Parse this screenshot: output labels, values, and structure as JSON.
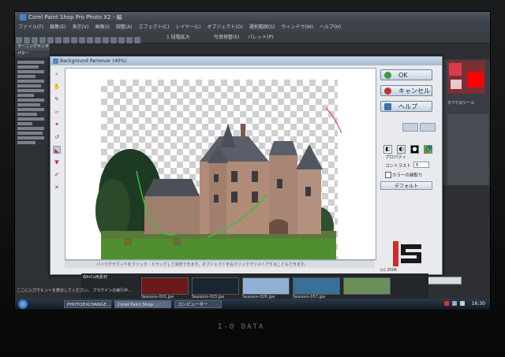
{
  "monitor": {
    "brand": "I-O DATA"
  },
  "app": {
    "title": "Corel Paint Shop Pro Photo X2 - 編",
    "menus": [
      "ファイル(F)",
      "編集(E)",
      "表示(V)",
      "画像(I)",
      "調整(A)",
      "エフェクト(C)",
      "レイヤー(L)",
      "オブジェクト(O)",
      "選択範囲(S)",
      "ウィンドウ(W)",
      "ヘルプ(H)"
    ],
    "toolbar_zoom": "1 段階拡大",
    "toolbar_right": [
      "写真修整(E)",
      "パレット(P)"
    ],
    "left_panel_title": "ラーニングセンター",
    "left_panel_heading": "パター",
    "right_panel_label": "すべてのツール"
  },
  "dialog": {
    "title": "Background Remover (40%)",
    "buttons": {
      "ok": "OK",
      "cancel": "キャンセル",
      "help": "ヘルプ",
      "default": "デフォルト"
    },
    "properties_label": "プロパティ",
    "contrast_label": "コントラスト",
    "contrast_value": "5",
    "color_fringe_label": "カラーの縁取り",
    "status_text": "バックグラウンドをクリック・ドラッグして消去できます。オブジェクトを右クリックでリストアすることもできます。",
    "copyright": "(c) 2006",
    "tools": [
      "zoom-icon",
      "pan-icon",
      "brush-icon",
      "eraser-icon",
      "magic-wand-icon",
      "lasso-icon",
      "restore-brush-icon",
      "fill-icon",
      "pen-icon",
      "delete-icon"
    ]
  },
  "organizer": {
    "folder": "WinCo用素材",
    "thumbnails": [
      "Seasons-001.jpe",
      "Seasons-003.jpe",
      "Seasons-026.jpe",
      "Seasons-057.jpe"
    ]
  },
  "hint": "ここに入力でヒントを表示してください。 プラグインの実行中...",
  "taskbar": {
    "items": [
      "PHOTOEXCHANGE...",
      "Corel Paint Shop ...",
      "コンピューター"
    ],
    "time": "16:30",
    "ime": "あ 般"
  },
  "colors": {
    "accent_red": "#ff0000",
    "dialog_bg": "#e9eaed"
  }
}
